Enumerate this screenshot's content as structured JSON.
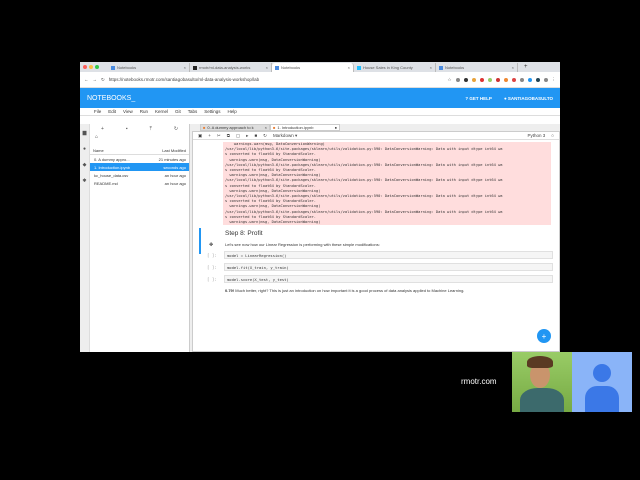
{
  "browser": {
    "tabs": [
      {
        "label": "Notebooks",
        "active": false
      },
      {
        "label": "rmotr/ml-data-analysis-works",
        "active": false
      },
      {
        "label": "Notebooks",
        "active": true
      },
      {
        "label": "House Sales in King County",
        "active": false
      },
      {
        "label": "Notebooks",
        "active": false
      }
    ],
    "url": "https://notebooks.rmotr.com/santiagobasulto/ml-data-analysis-workshop/lab"
  },
  "header": {
    "logo": "NOTEBOOKS_",
    "help": "GET HELP",
    "user": "SANTIAGOBASULTO"
  },
  "menu": [
    "File",
    "Edit",
    "View",
    "Run",
    "Kernel",
    "Git",
    "Tabs",
    "Settings",
    "Help"
  ],
  "filebrowser": {
    "col_name": "Name",
    "col_modified": "Last Modified",
    "files": [
      {
        "name": "0. A dummy appro...",
        "modified": "21 minutes ago"
      },
      {
        "name": "1. Introduction.ipynb",
        "modified": "seconds ago"
      },
      {
        "name": "kc_house_data.csv",
        "modified": "an hour ago"
      },
      {
        "name": "README.md",
        "modified": "an hour ago"
      }
    ]
  },
  "doc_tabs": [
    {
      "label": "0. A dummy approach to k"
    },
    {
      "label": "1. Introduction.ipynb"
    }
  ],
  "toolbar": {
    "cell_type": "Markdown",
    "kernel": "Python 3"
  },
  "stderr": "    warnings.warn(msg, DataConversionWarning)\n/usr/local/lib/python3.6/site-packages/sklearn/utils/validation.py:590: DataConversionWarning: Data with input dtype int64 wa\ns converted to float64 by StandardScaler.\n  warnings.warn(msg, DataConversionWarning)\n/usr/local/lib/python3.6/site-packages/sklearn/utils/validation.py:590: DataConversionWarning: Data with input dtype int64 wa\ns converted to float64 by StandardScaler.\n  warnings.warn(msg, DataConversionWarning)\n/usr/local/lib/python3.6/site-packages/sklearn/utils/validation.py:590: DataConversionWarning: Data with input dtype int64 wa\ns converted to float64 by StandardScaler.\n  warnings.warn(msg, DataConversionWarning)\n/usr/local/lib/python3.6/site-packages/sklearn/utils/validation.py:590: DataConversionWarning: Data with input dtype int64 wa\ns converted to float64 by StandardScaler.\n  warnings.warn(msg, DataConversionWarning)\n/usr/local/lib/python3.6/site-packages/sklearn/utils/validation.py:590: DataConversionWarning: Data with input dtype int64 wa\ns converted to float64 by StandardScaler.\n  warnings.warn(msg, DataConversionWarning)",
  "markdown": {
    "heading": "Step 8: Profit",
    "text": "Let's see now how our Linear Regression is performing with these simple modifications:"
  },
  "cells": [
    {
      "prompt": "[ ]:",
      "code": "model = LinearRegression()"
    },
    {
      "prompt": "[ ]:",
      "code": "model.fit(X_train, y_train)"
    },
    {
      "prompt": "[ ]:",
      "code": "model.score(X_test, y_test)"
    }
  ],
  "result": {
    "bold": "0.79!",
    "text": " Much better, right? This is just an introduction on how important it is a good process of data analysis applied to Machine Learning."
  },
  "overlay": {
    "brand": "rmotr.com"
  }
}
